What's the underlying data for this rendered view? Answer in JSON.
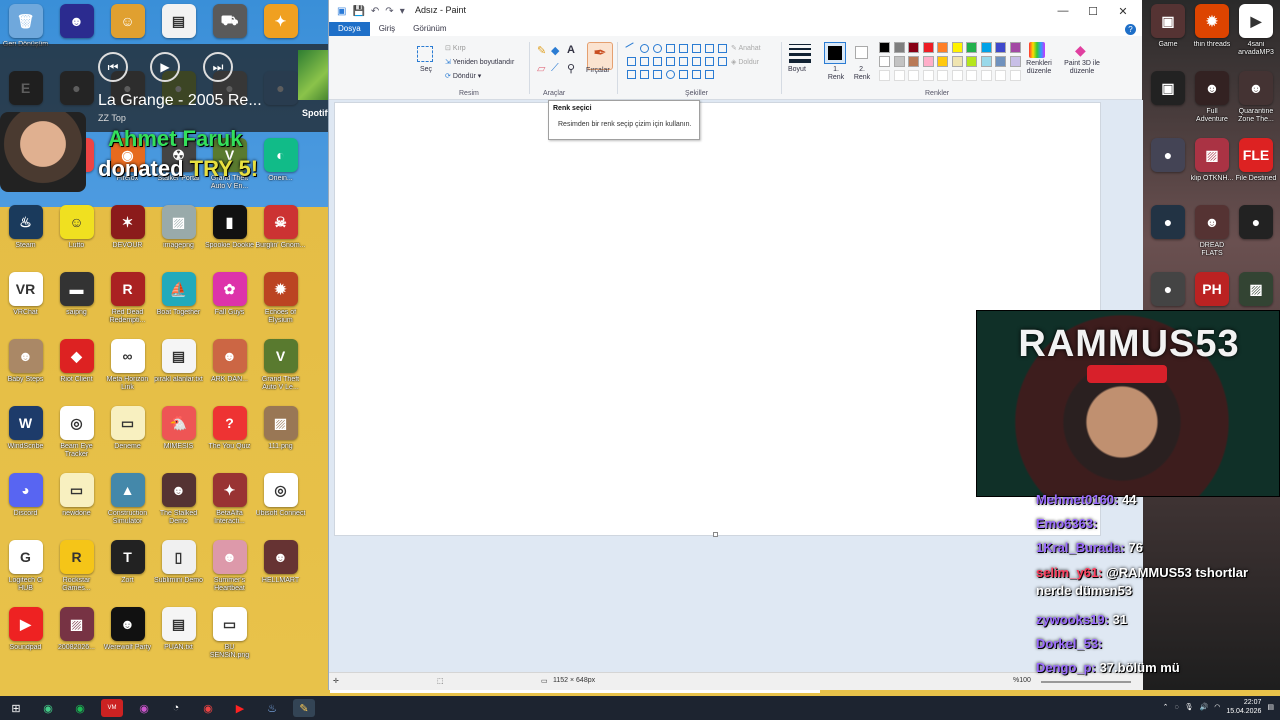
{
  "desktop": {
    "left_icons": [
      {
        "label": "Geri Dönüşüm",
        "color": "#6fa8dc",
        "glyph": "🗑"
      },
      {
        "label": "",
        "color": "#2b2b8f",
        "glyph": "☻"
      },
      {
        "label": "",
        "color": "#e0a030",
        "glyph": "☺"
      },
      {
        "label": "",
        "color": "#f2f2f2",
        "glyph": "▤"
      },
      {
        "label": "",
        "color": "#5a5a5a",
        "glyph": "⛟"
      },
      {
        "label": "",
        "color": "#f0a020",
        "glyph": "✦"
      },
      {
        "label": "",
        "color": "#222",
        "glyph": "E"
      },
      {
        "label": "",
        "color": "#333",
        "glyph": "●"
      },
      {
        "label": "",
        "color": "#555",
        "glyph": "●"
      },
      {
        "label": "",
        "color": "#8a3",
        "glyph": "●"
      },
      {
        "label": "",
        "color": "#777",
        "glyph": "●"
      },
      {
        "label": "",
        "color": "#48c",
        "glyph": "●"
      },
      {
        "label": "",
        "color": "#a33",
        "glyph": "●"
      },
      {
        "label": "",
        "color": "#e44",
        "glyph": "●"
      },
      {
        "label": "Firefox",
        "color": "#e66a1f",
        "glyph": "◉"
      },
      {
        "label": "Stalker Portal",
        "color": "#444",
        "glyph": "☢"
      },
      {
        "label": "Grand Theft Auto V En...",
        "color": "#597a2f",
        "glyph": "V"
      },
      {
        "label": "Onein...",
        "color": "#1b8",
        "glyph": "◐"
      },
      {
        "label": "Steam",
        "color": "#1a3a5c",
        "glyph": "♨"
      },
      {
        "label": "Lutto",
        "color": "#f0e020",
        "glyph": "☺"
      },
      {
        "label": "DEVOUR",
        "color": "#8b1b1b",
        "glyph": "✶"
      },
      {
        "label": "imagepng",
        "color": "#9aa",
        "glyph": "▨"
      },
      {
        "label": "Spookie Dookie",
        "color": "#111",
        "glyph": "▮"
      },
      {
        "label": "Burglin' Gnom...",
        "color": "#c33",
        "glyph": "☠"
      },
      {
        "label": "VRChat",
        "color": "#fff",
        "glyph": "VR"
      },
      {
        "label": "saipng",
        "color": "#333",
        "glyph": "▬"
      },
      {
        "label": "Red Dead Redempti...",
        "color": "#a22",
        "glyph": "R"
      },
      {
        "label": "Boat Together",
        "color": "#2ab",
        "glyph": "⛵"
      },
      {
        "label": "Fall Guys",
        "color": "#d3a",
        "glyph": "✿"
      },
      {
        "label": "Echoes of Elysium",
        "color": "#b42",
        "glyph": "✹"
      },
      {
        "label": "Baby Steps",
        "color": "#a86",
        "glyph": "☻"
      },
      {
        "label": "Riot Client",
        "color": "#d22",
        "glyph": "◆"
      },
      {
        "label": "Meta Horizon Link",
        "color": "#fff",
        "glyph": "∞"
      },
      {
        "label": "pirakl alanlar.txt",
        "color": "#f5f5f5",
        "glyph": "▤"
      },
      {
        "label": "ARK DAN...",
        "color": "#c64",
        "glyph": "☻"
      },
      {
        "label": "Grand Theft Auto V Le...",
        "color": "#597a2f",
        "glyph": "V"
      },
      {
        "label": "WindScribe",
        "color": "#1d3b6a",
        "glyph": "W"
      },
      {
        "label": "Beam Eye Tracker",
        "color": "#fff",
        "glyph": "◎"
      },
      {
        "label": "Deneme",
        "color": "#f8f0c0",
        "glyph": "▭"
      },
      {
        "label": "MIMESIS",
        "color": "#e55",
        "glyph": "🐔"
      },
      {
        "label": "The You Quiz",
        "color": "#e33",
        "glyph": "?"
      },
      {
        "label": "111.png",
        "color": "#975",
        "glyph": "▨"
      },
      {
        "label": "Discord",
        "color": "#5865f2",
        "glyph": "◕"
      },
      {
        "label": "newdone",
        "color": "#f8f0c0",
        "glyph": "▭"
      },
      {
        "label": "Construction Simulator",
        "color": "#48a",
        "glyph": "▲"
      },
      {
        "label": "The Stalked Demo",
        "color": "#533",
        "glyph": "☻"
      },
      {
        "label": "BetaAlfa Interacti...",
        "color": "#933",
        "glyph": "✦"
      },
      {
        "label": "Ubisoft Connect",
        "color": "#fff",
        "glyph": "◎"
      },
      {
        "label": "Logitech G HUB",
        "color": "#fff",
        "glyph": "G"
      },
      {
        "label": "Rockstar Games...",
        "color": "#f5c518",
        "glyph": "R"
      },
      {
        "label": "Zort",
        "color": "#222",
        "glyph": "T"
      },
      {
        "label": "Sublimini Demo",
        "color": "#f0f0f0",
        "glyph": "▯"
      },
      {
        "label": "Summer's Heartbeat",
        "color": "#d9a",
        "glyph": "☻"
      },
      {
        "label": "HELLMART",
        "color": "#633",
        "glyph": "☻"
      },
      {
        "label": "Soundpad",
        "color": "#e22",
        "glyph": "▶"
      },
      {
        "label": "20082026...",
        "color": "#734",
        "glyph": "▨"
      },
      {
        "label": "Werewolf Party",
        "color": "#111",
        "glyph": "☻"
      },
      {
        "label": "PUAN.txt",
        "color": "#f5f5f5",
        "glyph": "▤"
      },
      {
        "label": "BU SENSiN.png",
        "color": "#fff",
        "glyph": "▭"
      }
    ],
    "right_icons": [
      {
        "label": "Game",
        "color": "#533",
        "glyph": "▣"
      },
      {
        "label": "thin threads",
        "color": "#d40",
        "glyph": "✹"
      },
      {
        "label": "4sani arvadaMP3",
        "color": "#fff",
        "glyph": "▶"
      },
      {
        "label": "",
        "color": "#222",
        "glyph": "▣"
      },
      {
        "label": "Full Adventure",
        "color": "#322",
        "glyph": "☻"
      },
      {
        "label": "Quarantine Zone The...",
        "color": "#433",
        "glyph": "☻"
      },
      {
        "label": "",
        "color": "#445",
        "glyph": "●"
      },
      {
        "label": "klip OTKNH...",
        "color": "#a34",
        "glyph": "▨"
      },
      {
        "label": "File Destined",
        "color": "#d22",
        "glyph": "FLE"
      },
      {
        "label": "",
        "color": "#234",
        "glyph": "●"
      },
      {
        "label": "DREAD FLATS",
        "color": "#533",
        "glyph": "☻"
      },
      {
        "label": "",
        "color": "#222",
        "glyph": "●"
      },
      {
        "label": "",
        "color": "#444",
        "glyph": "●"
      },
      {
        "label": "",
        "color": "#b22",
        "glyph": "PH"
      },
      {
        "label": "",
        "color": "#343",
        "glyph": "▨"
      }
    ]
  },
  "spotify": {
    "track": "La Grange - 2005 Re...",
    "artist": "ZZ Top",
    "brand": "Spotify"
  },
  "donation": {
    "name": "Ahmet Faruk",
    "text_prefix": "donated ",
    "amount": "TRY 5!"
  },
  "paint": {
    "title": "Adsız - Paint",
    "tabs": [
      {
        "label": "Dosya",
        "active": true
      },
      {
        "label": "Giriş",
        "active": false
      },
      {
        "label": "Görünüm",
        "active": false
      }
    ],
    "ribbon": {
      "select_label": "Seç",
      "crop_label": "Kırp",
      "resize_label": "Yeniden boyutlandır",
      "rotate_label": "Döndür",
      "image_group": "Resim",
      "tools_group": "Araçlar",
      "brushes_label": "Fırçalar",
      "shapes_group": "Şekiller",
      "outline_label": "Anahat",
      "fill_label": "Doldur",
      "size_label": "Boyut",
      "color1_label": "1. Renk",
      "color2_label": "2. Renk",
      "edit_colors_label": "Renkleri düzenle",
      "paint3d_label": "Paint 3D ile düzenle",
      "colors_group": "Renkler"
    },
    "palette": [
      "#000000",
      "#7f7f7f",
      "#880015",
      "#ed1c24",
      "#ff7f27",
      "#fff200",
      "#22b14c",
      "#00a2e8",
      "#3f48cc",
      "#a349a4",
      "#ffffff",
      "#c3c3c3",
      "#b97a57",
      "#ffaec9",
      "#ffc90e",
      "#efe4b0",
      "#b5e61d",
      "#99d9ea",
      "#7092be",
      "#c8bfe7"
    ],
    "tooltip": {
      "title": "Renk seçici",
      "body": "Resimden bir renk seçip çizim için kullanın."
    },
    "status": {
      "canvas_size": "1152 × 648px",
      "zoom": "%100"
    }
  },
  "stream": {
    "webcam_banner": "RAMMUS53",
    "chat": [
      {
        "user": "Mehmet0160:",
        "msg": " 44",
        "style": "normal"
      },
      {
        "user": "Emo6363:",
        "msg": "",
        "style": "normal"
      },
      {
        "user": "1Kral_Burada:",
        "msg": " 76",
        "style": "normal"
      },
      {
        "user": "selim_y61:",
        "msg": " @RAMMUS53 tshortlar nerde dümen53",
        "style": "big"
      },
      {
        "user": "zywooks19:",
        "msg": " 31",
        "style": "normal"
      },
      {
        "user": "Dorkel_53:",
        "msg": "",
        "style": "normal"
      },
      {
        "user": "Dengo_p:",
        "msg": " 37.bölüm mü",
        "style": "normal"
      }
    ]
  },
  "taskbar": {
    "time": "22:07",
    "date": "15.04.2026"
  }
}
